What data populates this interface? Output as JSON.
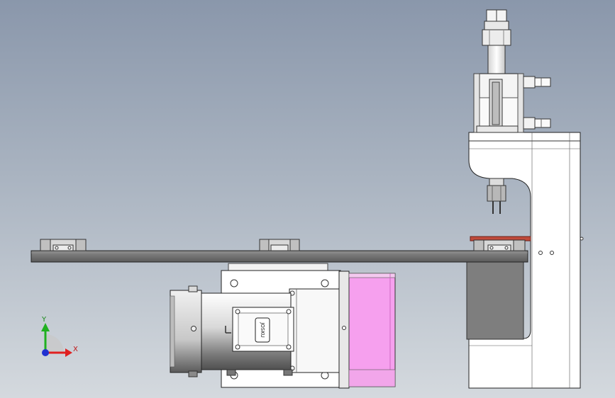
{
  "colors": {
    "background_top": "#8a97ab",
    "background_bottom": "#d4d9de",
    "plate": "#6c6c6c",
    "pink_block": "#f6a0ee",
    "pcb": "#c04a3a",
    "axis_x": "#e02020",
    "axis_y": "#20b020",
    "axis_z": "#2030d0"
  },
  "labels": {
    "motor_badge": "JOSKU",
    "axis_x": "X",
    "axis_y": "Y"
  }
}
